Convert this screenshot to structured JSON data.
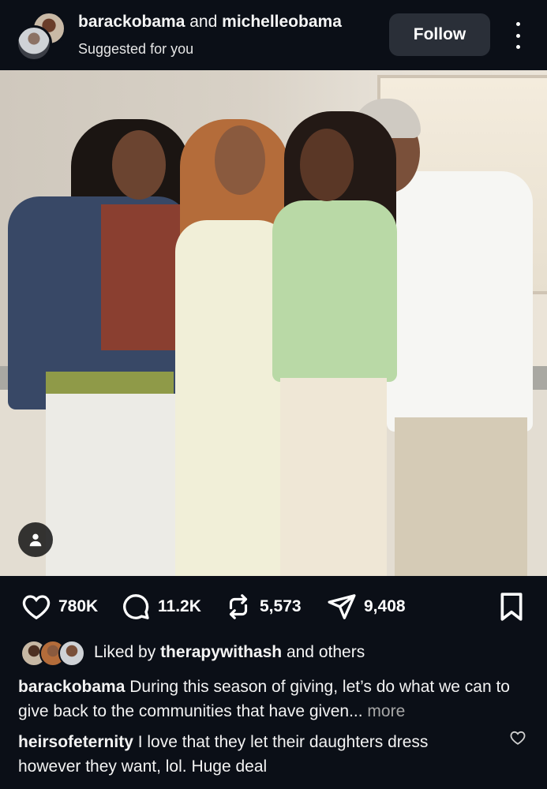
{
  "header": {
    "user1": "barackobama",
    "and": "and",
    "user2": "michelleobama",
    "subtitle": "Suggested for you",
    "follow_label": "Follow"
  },
  "actions": {
    "likes": "780K",
    "comments": "11.2K",
    "reposts": "5,573",
    "shares": "9,408"
  },
  "liked_by": {
    "prefix": "Liked by",
    "user": "therapywithash",
    "suffix": "and others"
  },
  "caption": {
    "user": "barackobama",
    "text": "During this season of giving, let’s do what we can to give back to the communities that have given...",
    "more": "more"
  },
  "top_comment": {
    "user": "heirsofeternity",
    "text": "I love that they let their daughters dress however they want, lol. Huge deal"
  },
  "icons": [
    "more-vertical-icon",
    "user-tag-icon",
    "heart-icon",
    "comment-icon",
    "repost-icon",
    "share-icon",
    "bookmark-icon"
  ]
}
